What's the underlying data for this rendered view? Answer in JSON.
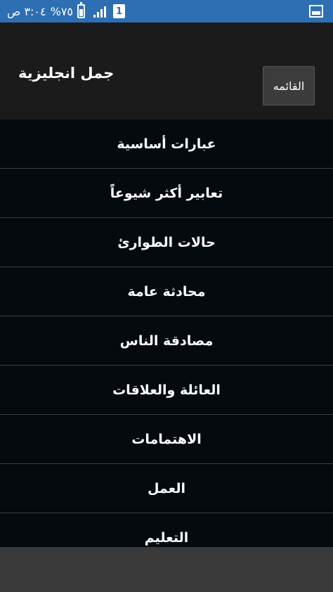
{
  "status_bar": {
    "time": "٣:٠٤ ص",
    "battery": "%٧٥",
    "sim_label": "1",
    "background_color": "#2e6fb3",
    "notification_icon": "image-icon"
  },
  "app_bar": {
    "title": "جمل انجليزية",
    "menu_button": "القائمه"
  },
  "list": {
    "items": [
      {
        "label": "عبارات أساسية"
      },
      {
        "label": "تعابير أكثر شيوعاً"
      },
      {
        "label": "حالات الطوارئ"
      },
      {
        "label": "محادثة عامة"
      },
      {
        "label": "مصادقة الناس"
      },
      {
        "label": "العائلة والعلاقات"
      },
      {
        "label": "الاهتمامات"
      },
      {
        "label": "العمل"
      },
      {
        "label": "التعليم"
      }
    ]
  }
}
